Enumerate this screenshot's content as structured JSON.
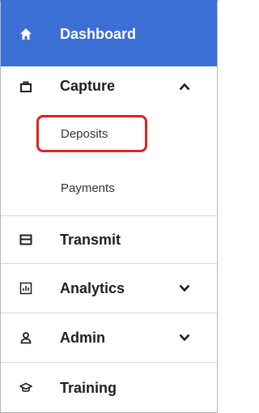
{
  "nav": {
    "dashboard": {
      "label": "Dashboard",
      "icon": "home-icon"
    },
    "capture": {
      "label": "Capture",
      "icon": "briefcase-icon",
      "expanded": true,
      "children": [
        {
          "label": "Deposits"
        },
        {
          "label": "Payments"
        }
      ]
    },
    "transmit": {
      "label": "Transmit",
      "icon": "transmit-icon"
    },
    "analytics": {
      "label": "Analytics",
      "icon": "analytics-icon"
    },
    "admin": {
      "label": "Admin",
      "icon": "user-icon"
    },
    "training": {
      "label": "Training",
      "icon": "graduation-cap-icon"
    }
  },
  "colors": {
    "active_bg": "#3b6fd6",
    "highlight": "#dc2323"
  }
}
